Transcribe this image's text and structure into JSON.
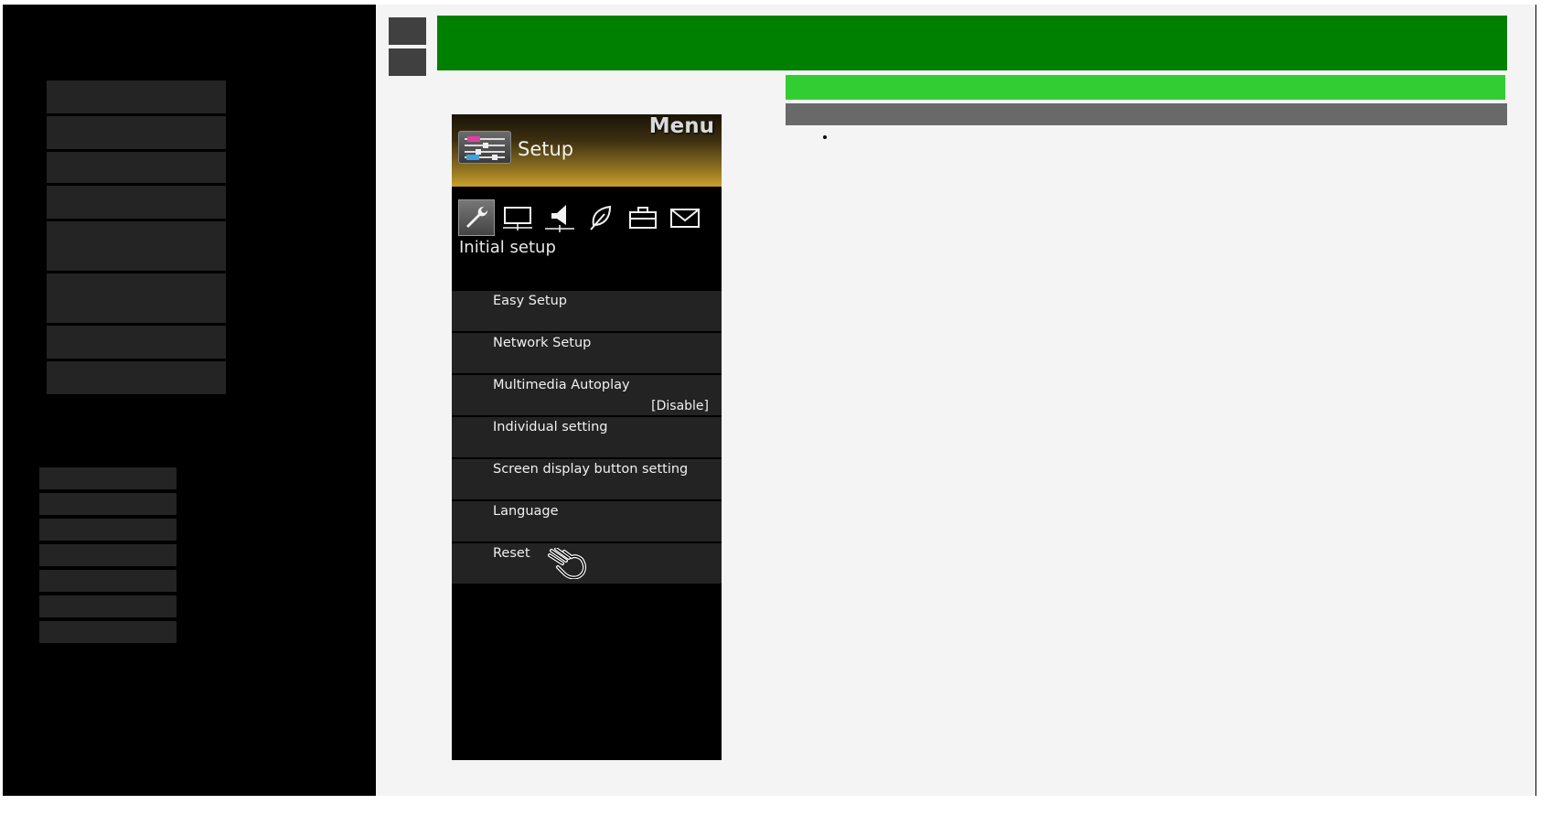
{
  "tv_menu": {
    "header_label": "Menu",
    "title": "Setup",
    "section": "Initial setup",
    "icon_tabs": [
      {
        "icon": "wrench-icon",
        "active": true
      },
      {
        "icon": "monitor-icon",
        "active": false
      },
      {
        "icon": "speaker-icon",
        "active": false
      },
      {
        "icon": "leaf-icon",
        "active": false
      },
      {
        "icon": "toolbox-icon",
        "active": false
      },
      {
        "icon": "envelope-icon",
        "active": false
      }
    ],
    "items": [
      {
        "label": "Easy Setup",
        "value": ""
      },
      {
        "label": "Network Setup",
        "value": ""
      },
      {
        "label": "Multimedia Autoplay",
        "value": "[Disable]"
      },
      {
        "label": "Individual setting",
        "value": ""
      },
      {
        "label": "Screen display button setting",
        "value": ""
      },
      {
        "label": "Language",
        "value": ""
      },
      {
        "label": "Reset",
        "value": ""
      }
    ]
  },
  "colors": {
    "title_bar": "#008000",
    "sub_bar_green": "#32cd32",
    "sub_bar_gray": "#696969",
    "content_bg": "#f4f4f4",
    "nav_block": "#242424"
  }
}
